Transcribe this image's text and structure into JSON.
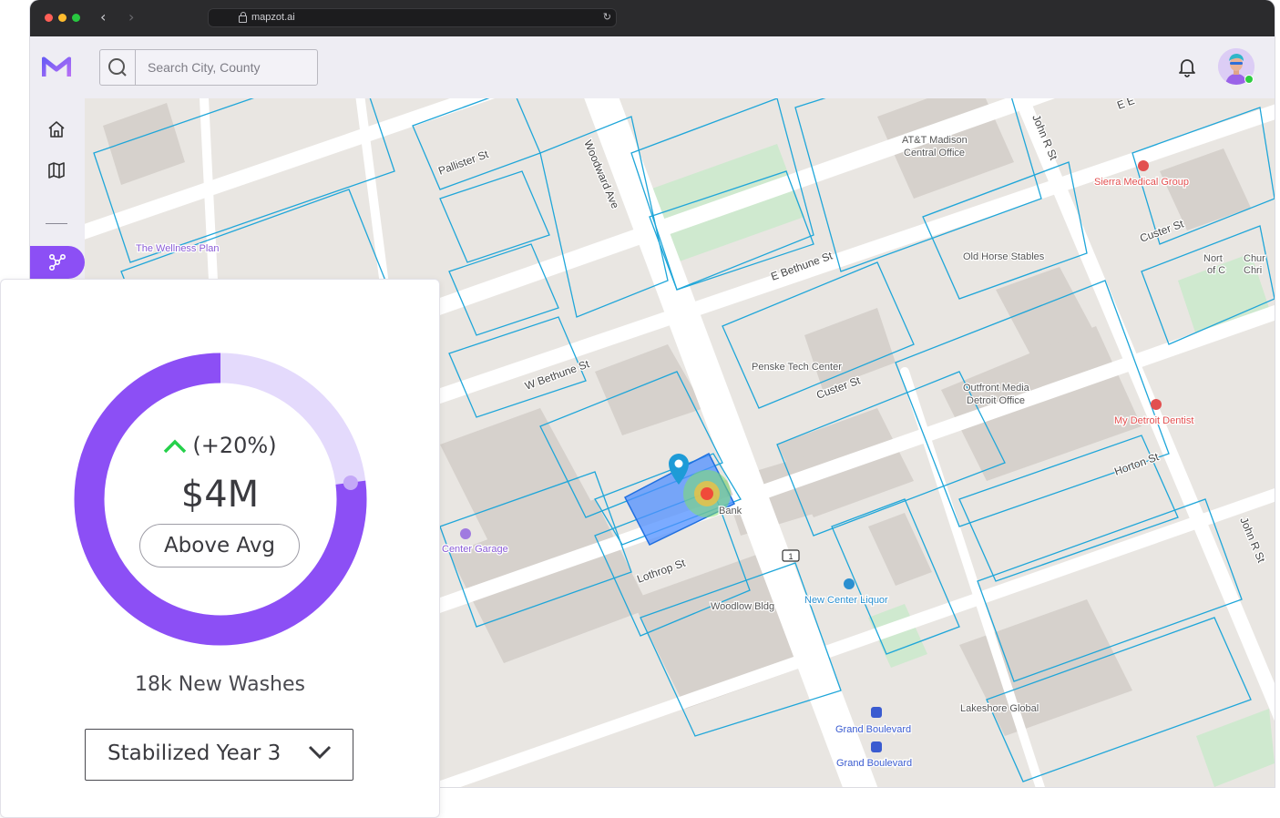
{
  "browser": {
    "url": "mapzot.ai",
    "back": "‹",
    "forward": "›",
    "reload": "↻"
  },
  "header": {
    "search_placeholder": "Search City, County",
    "notification_icon": "bell-icon",
    "avatar_icon": "avatar"
  },
  "sidebar": {
    "items": [
      {
        "icon": "home-icon"
      },
      {
        "icon": "map-icon"
      },
      {
        "icon": "network-icon",
        "active": true
      }
    ]
  },
  "map": {
    "streets": [
      {
        "name": "Pallister St"
      },
      {
        "name": "Woodward Ave"
      },
      {
        "name": "John R St"
      },
      {
        "name": "E Bethune St"
      },
      {
        "name": "W Bethune St"
      },
      {
        "name": "Custer St"
      },
      {
        "name": "Custer St"
      },
      {
        "name": "Horton St"
      },
      {
        "name": "Lothrop St"
      },
      {
        "name": "John R St"
      },
      {
        "name": "E E"
      }
    ],
    "places": [
      {
        "name": "AT&T Madison"
      },
      {
        "name": "Central Office"
      },
      {
        "name": "Sierra Medical Group"
      },
      {
        "name": "The Wellness Plan"
      },
      {
        "name": "Old Horse Stables"
      },
      {
        "name": "Penske Tech Center"
      },
      {
        "name": "Outfront Media"
      },
      {
        "name": "Detroit Office"
      },
      {
        "name": "My Detroit Dentist"
      },
      {
        "name": "Center Garage"
      },
      {
        "name": "Woodlow Bldg"
      },
      {
        "name": "New Center Liquor"
      },
      {
        "name": "Lakeshore Global"
      },
      {
        "name": "Grand Boulevard"
      },
      {
        "name": "Grand Boulevard"
      },
      {
        "name": "Bank"
      },
      {
        "name": "Nort"
      },
      {
        "name": "Chur"
      },
      {
        "name": "of C"
      },
      {
        "name": "Chri"
      }
    ],
    "route_shield": "1",
    "controls": [
      {
        "icon": "fullscreen-icon"
      },
      {
        "icon": "zoom-in-icon"
      },
      {
        "icon": "zoom-out-icon"
      },
      {
        "icon": "search-icon"
      },
      {
        "icon": "layers-icon"
      },
      {
        "icon": "globe-icon"
      },
      {
        "icon": "car-icon"
      },
      {
        "icon": "street-view-icon"
      },
      {
        "icon": "map-pin-icon"
      }
    ],
    "colors": {
      "parcel": "#1fa6d9",
      "road": "#ffffff",
      "building": "#d6d1cc",
      "park": "#cfe9cf",
      "selection": "#4f8fff"
    }
  },
  "stats_card": {
    "change_text": "(+20%)",
    "value": "$4M",
    "badge": "Above Avg",
    "subtitle": "18k New Washes",
    "select_value": "Stabilized Year 3",
    "gauge_fraction": 0.77,
    "colors": {
      "gauge_fill": "#8c4ff5",
      "gauge_track": "#e4dafc",
      "up_arrow": "#25d04a"
    }
  }
}
